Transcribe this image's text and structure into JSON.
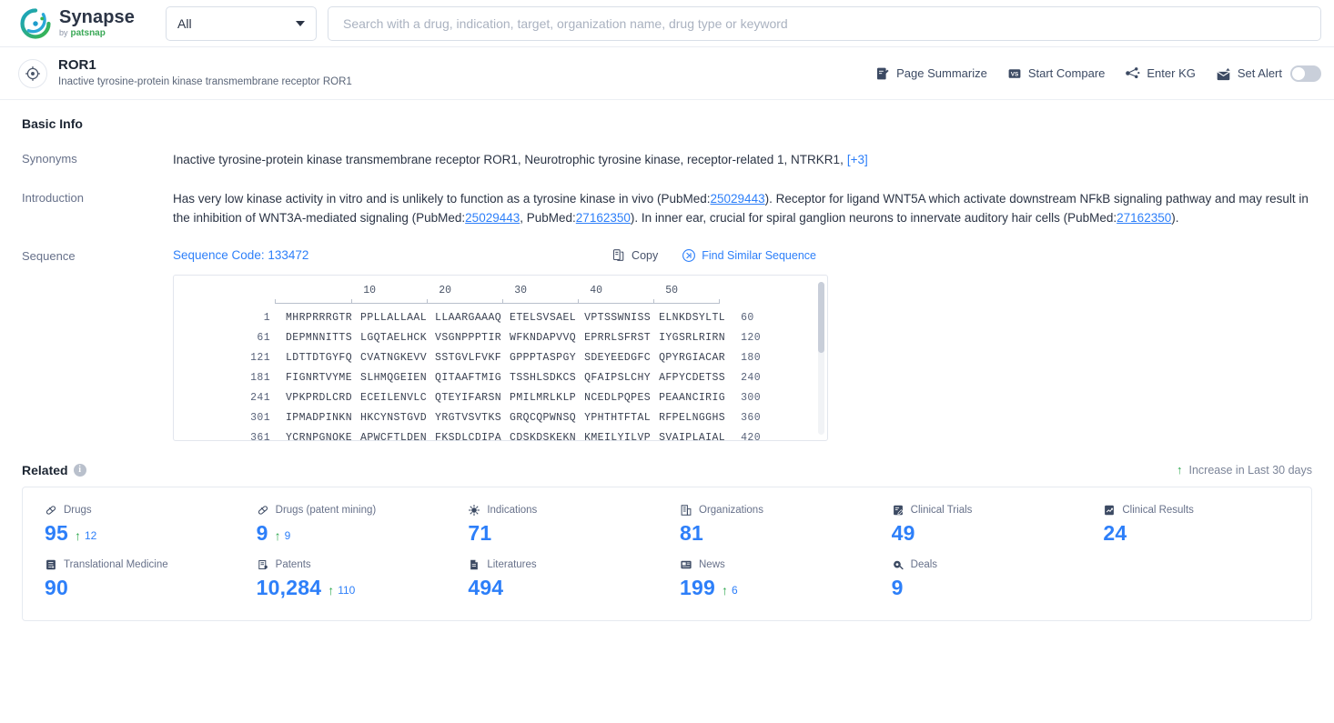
{
  "topbar": {
    "brand_name": "Synapse",
    "brand_by": "by",
    "brand_company": "patsnap",
    "scope_value": "All",
    "search_placeholder": "Search with a drug, indication, target, organization name, drug type or keyword",
    "search_value": ""
  },
  "entity": {
    "title": "ROR1",
    "subtitle": "Inactive tyrosine-protein kinase transmembrane receptor ROR1",
    "actions": [
      {
        "label": "Page Summarize",
        "icon": "page-summarize-icon"
      },
      {
        "label": "Start Compare",
        "icon": "versus-icon"
      },
      {
        "label": "Enter KG",
        "icon": "knowledge-graph-icon"
      },
      {
        "label": "Set Alert",
        "icon": "alert-mail-icon"
      }
    ],
    "alert_enabled": false
  },
  "basic_info": {
    "section_title": "Basic Info",
    "synonyms_label": "Synonyms",
    "synonyms_text": "Inactive tyrosine-protein kinase transmembrane receptor ROR1,  Neurotrophic tyrosine kinase, receptor-related 1,  NTRKR1,",
    "synonyms_more": "[+3]",
    "introduction_label": "Introduction",
    "introduction_parts": {
      "p1": "Has very low kinase activity in vitro and is unlikely to function as a tyrosine kinase in vivo (PubMed:",
      "pm1": "25029443",
      "p2": "). Receptor for ligand WNT5A which activate downstream NFkB signaling pathway and may result in the inhibition of WNT3A-mediated signaling (PubMed:",
      "pm2": "25029443",
      "p3": ", PubMed:",
      "pm3": "27162350",
      "p4": "). In inner ear, crucial for spiral ganglion neurons to innervate auditory hair cells (PubMed:",
      "pm4": "27162350",
      "p5": ")."
    },
    "sequence_label": "Sequence",
    "sequence_code": "Sequence Code: 133472",
    "copy_label": "Copy",
    "find_similar_label": "Find Similar Sequence",
    "ruler_ticks": [
      "10",
      "20",
      "30",
      "40",
      "50"
    ],
    "sequence_rows": [
      {
        "start": "1",
        "chunks": [
          "MHRPRRRGTR",
          "PPLLALLAAL",
          "LLAARGAAAQ",
          "ETELSVSAEL",
          "VPTSSWNISS",
          "ELNKDSYLTL"
        ],
        "end": "60"
      },
      {
        "start": "61",
        "chunks": [
          "DEPMNNITTS",
          "LGQTAELHCK",
          "VSGNPPPTIR",
          "WFKNDAPVVQ",
          "EPRRLSFRST",
          "IYGSRLRIRN"
        ],
        "end": "120"
      },
      {
        "start": "121",
        "chunks": [
          "LDTTDTGYFQ",
          "CVATNGKEVV",
          "SSTGVLFVKF",
          "GPPPTASPGY",
          "SDEYEEDGFC",
          "QPYRGIACAR"
        ],
        "end": "180"
      },
      {
        "start": "181",
        "chunks": [
          "FIGNRTVYME",
          "SLHMQGEIEN",
          "QITAAFTMIG",
          "TSSHLSDKCS",
          "QFAIPSLCHY",
          "AFPYCDETSS"
        ],
        "end": "240"
      },
      {
        "start": "241",
        "chunks": [
          "VPKPRDLCRD",
          "ECEILENVLC",
          "QTEYIFARSN",
          "PMILMRLKLP",
          "NCEDLPQPES",
          "PEAANCIRIG"
        ],
        "end": "300"
      },
      {
        "start": "301",
        "chunks": [
          "IPMADPINKN",
          "HKCYNSTGVD",
          "YRGTVSVTKS",
          "GRQCQPWNSQ",
          "YPHTHTFTAL",
          "RFPELNGGHS"
        ],
        "end": "360"
      },
      {
        "start": "361",
        "chunks": [
          "YCRNPGNQKE",
          "APWCFTLDEN",
          "FKSDLCDIPA",
          "CDSKDSKEKN",
          "KMEILYILVP",
          "SVAIPLAIAL"
        ],
        "end": "420"
      }
    ]
  },
  "related": {
    "title": "Related",
    "legend": "Increase in Last 30 days",
    "items": [
      {
        "label": "Drugs",
        "value": "95",
        "delta": "12",
        "icon": "pill-icon"
      },
      {
        "label": "Drugs (patent mining)",
        "value": "9",
        "delta": "9",
        "icon": "pill-icon"
      },
      {
        "label": "Indications",
        "value": "71",
        "delta": "",
        "icon": "virus-icon"
      },
      {
        "label": "Organizations",
        "value": "81",
        "delta": "",
        "icon": "building-icon"
      },
      {
        "label": "Clinical Trials",
        "value": "49",
        "delta": "",
        "icon": "clipboard-edit-icon"
      },
      {
        "label": "Clinical Results",
        "value": "24",
        "delta": "",
        "icon": "results-chart-icon"
      },
      {
        "label": "Translational Medicine",
        "value": "90",
        "delta": "",
        "icon": "flow-node-icon"
      },
      {
        "label": "Patents",
        "value": "10,284",
        "delta": "110",
        "icon": "patent-icon"
      },
      {
        "label": "Literatures",
        "value": "494",
        "delta": "",
        "icon": "document-icon"
      },
      {
        "label": "News",
        "value": "199",
        "delta": "6",
        "icon": "news-icon"
      },
      {
        "label": "Deals",
        "value": "9",
        "delta": "",
        "icon": "deal-icon"
      }
    ]
  },
  "colors": {
    "accent_blue": "#2d7ff9",
    "up_green": "#2fa84f",
    "text_dark": "#1d2633",
    "text_muted": "#67718a"
  }
}
